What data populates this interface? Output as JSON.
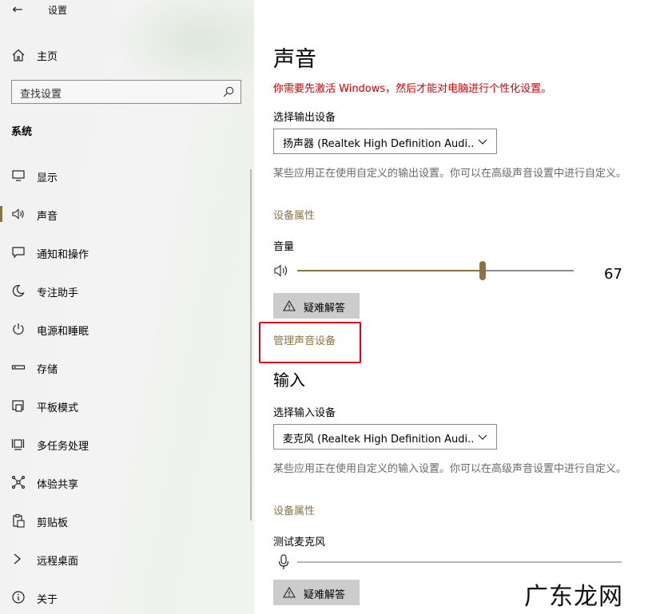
{
  "window": {
    "title": "设置",
    "back_label": "←"
  },
  "sidebar": {
    "home_label": "主页",
    "search_placeholder": "查找设置",
    "section_title": "系统",
    "items": [
      {
        "label": "显示",
        "icon": "display-icon"
      },
      {
        "label": "声音",
        "icon": "speaker-icon",
        "active": true
      },
      {
        "label": "通知和操作",
        "icon": "notification-icon"
      },
      {
        "label": "专注助手",
        "icon": "moon-icon"
      },
      {
        "label": "电源和睡眠",
        "icon": "power-icon"
      },
      {
        "label": "存储",
        "icon": "storage-icon"
      },
      {
        "label": "平板模式",
        "icon": "tablet-icon"
      },
      {
        "label": "多任务处理",
        "icon": "multitask-icon"
      },
      {
        "label": "体验共享",
        "icon": "share-icon"
      },
      {
        "label": "剪贴板",
        "icon": "clipboard-icon"
      },
      {
        "label": "远程桌面",
        "icon": "remote-icon"
      },
      {
        "label": "关于",
        "icon": "info-icon"
      }
    ]
  },
  "main": {
    "title": "声音",
    "activation_warning": "你需要先激活 Windows，然后才能对电脑进行个性化设置。",
    "output": {
      "select_label": "选择输出设备",
      "device": "扬声器 (Realtek High Definition Audi...",
      "description": "某些应用正在使用自定义的输出设置。你可以在高级声音设置中进行自定义。",
      "properties_link": "设备属性",
      "volume_label": "音量",
      "volume_value": "67",
      "volume_level": 0.67,
      "troubleshoot_label": "疑难解答",
      "manage_link": "管理声音设备"
    },
    "input": {
      "heading": "输入",
      "select_label": "选择输入设备",
      "device": "麦克风 (Realtek High Definition Audi...",
      "description": "某些应用正在使用自定义的输入设置。你可以在高级声音设置中进行自定义。",
      "properties_link": "设备属性",
      "test_label": "测试麦克风",
      "troubleshoot_label": "疑难解答"
    }
  },
  "watermark": "广东龙网",
  "colors": {
    "accent": "#8a7443",
    "warning": "#d40000",
    "highlight": "#e0001a"
  }
}
